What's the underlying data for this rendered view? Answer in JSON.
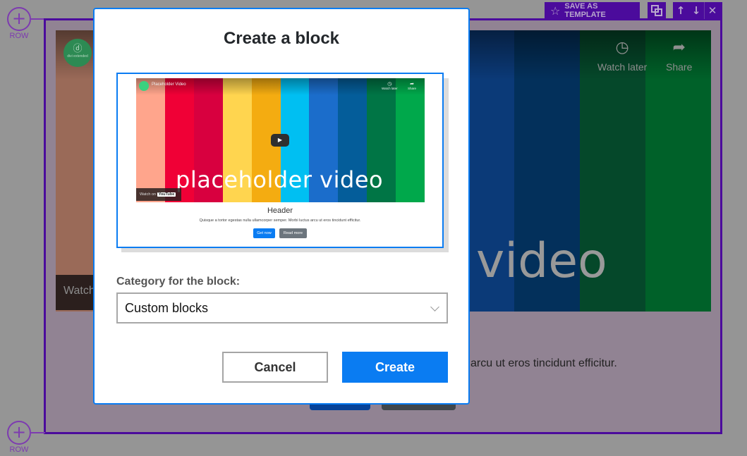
{
  "builder": {
    "row_add_label": "ROW",
    "row_add_icon": "+",
    "toolbar": {
      "save_as_template_label": "SAVE AS TEMPLATE",
      "save_icon": "☆",
      "duplicate_icon": "⧉",
      "move_up_icon": "↑",
      "move_down_icon": "↓",
      "close_icon": "✕"
    },
    "colors": {
      "accent": "#4b0b9c",
      "row_add": "#7d3bb0",
      "overlay": "#959595"
    }
  },
  "background_content": {
    "video": {
      "stripes": [
        "#9a6a58",
        "#2b1f1d",
        "#2b1f1d",
        "#2b1f1d",
        "#2b1f1d",
        "#2b1f1d",
        "#0b3a78",
        "#03305b",
        "#05482a",
        "#006129"
      ],
      "logo_glyph": "ⓓ",
      "logo_text": "divi extended",
      "watch_on": "Watch",
      "watch_later": "Watch later",
      "watch_later_icon": "◷",
      "share": "Share",
      "share_icon": "➦",
      "overlay_text": "video"
    },
    "paragraph_tail": "arcu ut eros tincidunt efficitur."
  },
  "modal": {
    "title": "Create a block",
    "preview": {
      "stripes": [
        "#ffa58c",
        "#f00036",
        "#d8003f",
        "#ffd54f",
        "#f4ac11",
        "#00bff2",
        "#1b6dcb",
        "#045d9a",
        "#007545",
        "#00a84b"
      ],
      "channel": "Placeholder Video",
      "watch_later": "Watch later",
      "watch_later_icon": "◷",
      "share": "Share",
      "share_icon": "➦",
      "play_icon": "▶",
      "overlay_text": "placeholder video",
      "watch_on": "Watch on",
      "youtube": "YouTube",
      "header": "Header",
      "paragraph": "Quisque a tortor egestas nulla ullamcorper semper. Morbi luctus arcu ut eros tincidunt efficitur.",
      "primary_button": "Get now",
      "secondary_button": "Read more"
    },
    "category_label": "Category for the block:",
    "category_value": "Custom blocks",
    "cancel_label": "Cancel",
    "create_label": "Create",
    "accent_color": "#0a7cf2"
  }
}
